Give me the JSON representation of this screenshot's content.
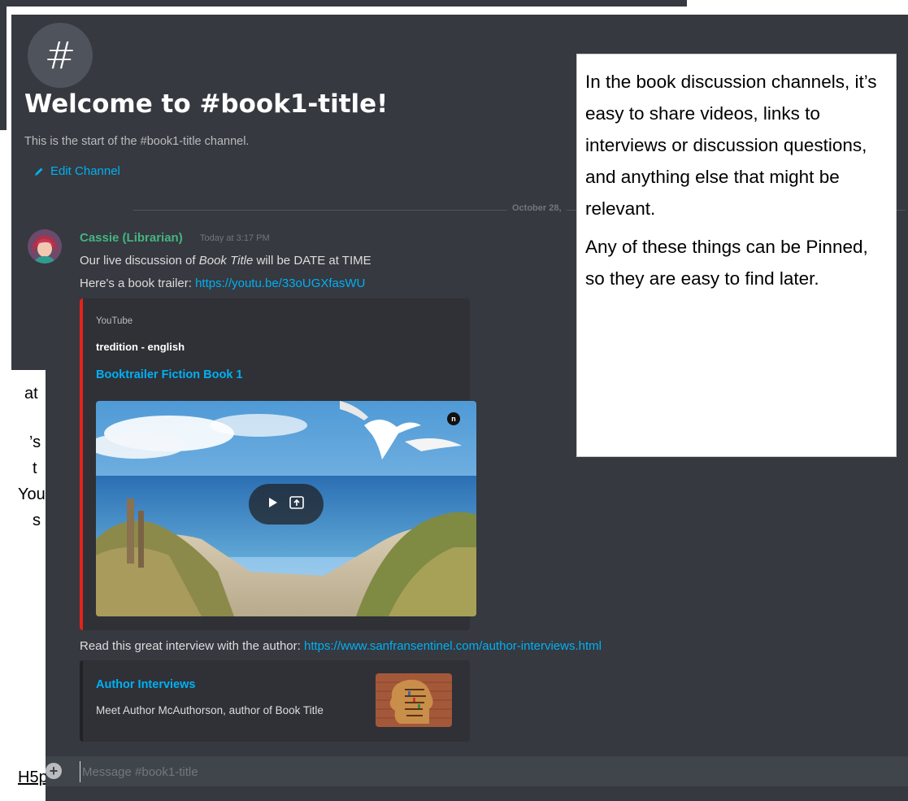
{
  "channel": {
    "hash_glyph": "#",
    "welcome_title": "Welcome to #book1-title!",
    "welcome_subtitle": "This is the start of the #book1-title channel.",
    "edit_channel_label": "Edit Channel",
    "date_divider": "October 28, "
  },
  "message": {
    "author": "Cassie (Librarian)",
    "timestamp": "Today at 3:17 PM",
    "line1_prefix": "Our live discussion of ",
    "line1_italic": "Book Title",
    "line1_suffix": " will be DATE at TIME",
    "line2_prefix": "Here's a book trailer: ",
    "line2_link": "https://youtu.be/33oUGXfasWU",
    "line3_prefix": "Read this great interview with the author: ",
    "line3_link": "https://www.sanfransentinel.com/author-interviews.html"
  },
  "embed_youtube": {
    "provider": "YouTube",
    "author": "tredition - english",
    "title": "Booktrailer Fiction Book 1",
    "corner_badge": "n"
  },
  "embed_article": {
    "title": "Author Interviews",
    "description": "Meet Author McAuthorson, author of Book Title"
  },
  "composer": {
    "placeholder": "Message #book1-title",
    "plus_glyph": "+"
  },
  "callout_right": {
    "para1": "In the book discussion channels, it’s easy to share videos, links to interviews or discussion questions, and anything else that might be relevant.",
    "para2": "Any of these things can be Pinned, so they are easy to find later."
  },
  "callout_left_fragments": [
    "at",
    "",
    "’s",
    "t",
    "You",
    "s"
  ],
  "background_link_fragment": "H5p",
  "colors": {
    "discord_bg": "#36393f",
    "embed_bg": "#2f3136",
    "link": "#00b0f4",
    "author_green": "#43b581",
    "youtube_red": "#e3231a"
  }
}
